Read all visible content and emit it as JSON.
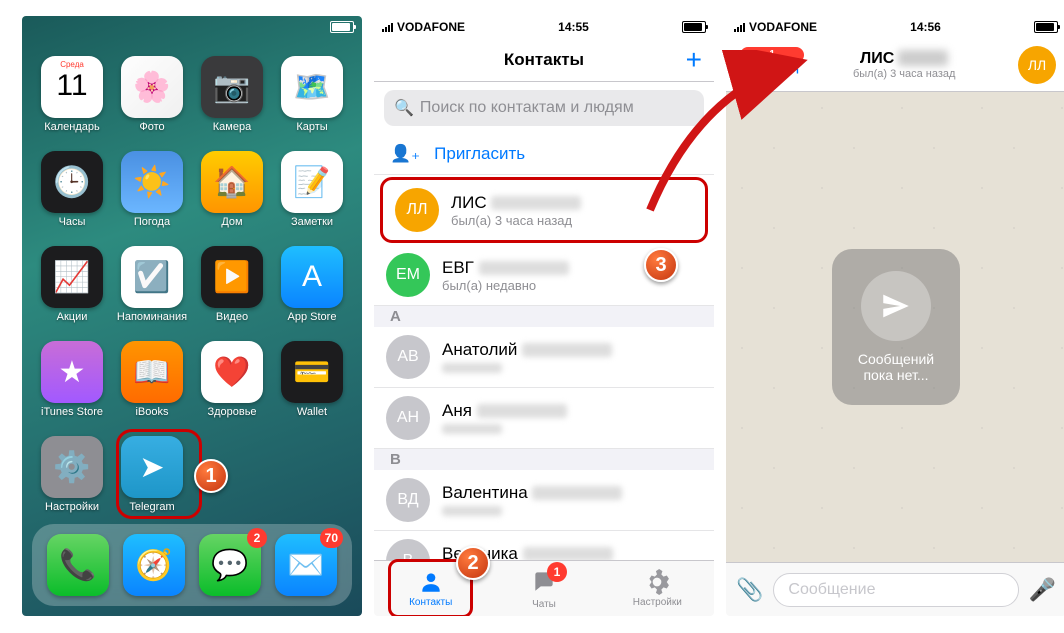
{
  "status": {
    "carrier": "VODAFONE",
    "time1": "14:55",
    "time2": "14:55",
    "time3": "14:56"
  },
  "home": {
    "apps": [
      {
        "label": "Календарь",
        "bg": "#fff",
        "glyph": "11",
        "top": "Среда"
      },
      {
        "label": "Фото",
        "bg": "linear-gradient(135deg,#fefefe,#f0f0f0)",
        "glyph": "🌸"
      },
      {
        "label": "Камера",
        "bg": "#3a3a3c",
        "glyph": "📷"
      },
      {
        "label": "Карты",
        "bg": "#fff",
        "glyph": "🗺️"
      },
      {
        "label": "Часы",
        "bg": "#1c1c1e",
        "glyph": "🕒"
      },
      {
        "label": "Погода",
        "bg": "linear-gradient(#4a90e2,#6bb6ff)",
        "glyph": "☀️"
      },
      {
        "label": "Дом",
        "bg": "linear-gradient(#ffcc00,#ff9500)",
        "glyph": "🏠"
      },
      {
        "label": "Заметки",
        "bg": "#fff",
        "glyph": "📝"
      },
      {
        "label": "Акции",
        "bg": "#1c1c1e",
        "glyph": "📈"
      },
      {
        "label": "Напоминания",
        "bg": "#fff",
        "glyph": "☑️"
      },
      {
        "label": "Видео",
        "bg": "#1c1c1e",
        "glyph": "▶️"
      },
      {
        "label": "App Store",
        "bg": "linear-gradient(#1fbeff,#0a84ff)",
        "glyph": "A"
      },
      {
        "label": "iTunes Store",
        "bg": "linear-gradient(#c86dd7,#a259ff)",
        "glyph": "★"
      },
      {
        "label": "iBooks",
        "bg": "linear-gradient(#ff9500,#ff6b00)",
        "glyph": "📖"
      },
      {
        "label": "Здоровье",
        "bg": "#fff",
        "glyph": "❤️"
      },
      {
        "label": "Wallet",
        "bg": "#1c1c1e",
        "glyph": "💳"
      },
      {
        "label": "Настройки",
        "bg": "#8e8e93",
        "glyph": "⚙️"
      },
      {
        "label": "Telegram",
        "bg": "linear-gradient(#37aee2,#1e96c8)",
        "glyph": "➤"
      }
    ],
    "dock": [
      {
        "bg": "linear-gradient(#66d464,#0bbd2a)",
        "glyph": "📞"
      },
      {
        "bg": "linear-gradient(#1fbeff,#0a84ff)",
        "glyph": "🧭"
      },
      {
        "bg": "linear-gradient(#66d464,#0bbd2a)",
        "glyph": "💬",
        "badge": "2"
      },
      {
        "bg": "linear-gradient(#1fbeff,#0a84ff)",
        "glyph": "✉️",
        "badge": "70"
      }
    ]
  },
  "contacts": {
    "title": "Контакты",
    "search_ph": "Поиск по контактам и людям",
    "invite": "Пригласить",
    "list": [
      {
        "avatar": "ЛЛ",
        "color": "#f7a500",
        "name": "ЛИС",
        "sub": "был(а) 3 часа назад",
        "hl": true
      },
      {
        "avatar": "ЕМ",
        "color": "#34c759",
        "name": "ЕВГ",
        "sub": "был(а) недавно"
      }
    ],
    "section_a": "А",
    "list_a": [
      {
        "avatar": "АВ",
        "color": "#c7c7cc",
        "name": "Анатолий"
      },
      {
        "avatar": "АН",
        "color": "#c7c7cc",
        "name": "Аня"
      }
    ],
    "section_v": "В",
    "list_v": [
      {
        "avatar": "ВД",
        "color": "#c7c7cc",
        "name": "Валентина"
      },
      {
        "avatar": "В",
        "color": "#c7c7cc",
        "name": "Вероника"
      }
    ],
    "tabs": [
      {
        "label": "Контакты",
        "active": true
      },
      {
        "label": "Чаты",
        "badge": "1"
      },
      {
        "label": "Настройки"
      }
    ]
  },
  "chat": {
    "back": "Назад",
    "name": "ЛИС",
    "sub": "был(а) 3 часа назад",
    "avatar": "ЛЛ",
    "empty": "Сообщений\nпока нет...",
    "input_ph": "Сообщение"
  },
  "callouts": {
    "c1": "1",
    "c2": "2",
    "c3": "3"
  }
}
